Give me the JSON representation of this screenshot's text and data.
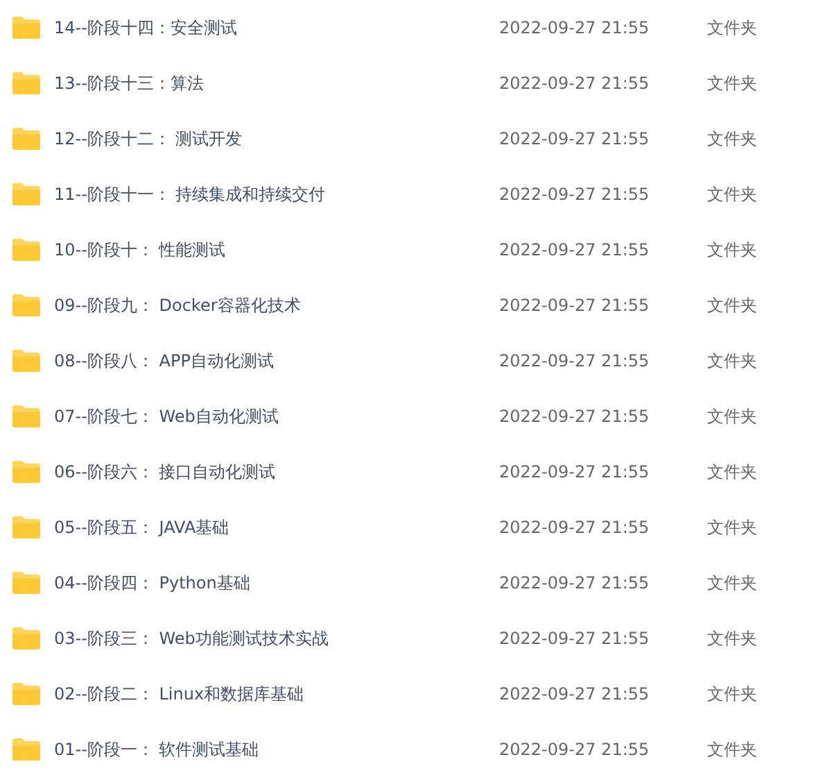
{
  "files": [
    {
      "name": "14--阶段十四：安全测试",
      "modified": "2022-09-27 21:55",
      "type": "文件夹"
    },
    {
      "name": "13--阶段十三：算法",
      "modified": "2022-09-27 21:55",
      "type": "文件夹"
    },
    {
      "name": "12--阶段十二： 测试开发",
      "modified": "2022-09-27 21:55",
      "type": "文件夹"
    },
    {
      "name": "11--阶段十一： 持续集成和持续交付",
      "modified": "2022-09-27 21:55",
      "type": "文件夹"
    },
    {
      "name": "10--阶段十： 性能测试",
      "modified": "2022-09-27 21:55",
      "type": "文件夹"
    },
    {
      "name": "09--阶段九： Docker容器化技术",
      "modified": "2022-09-27 21:55",
      "type": "文件夹"
    },
    {
      "name": "08--阶段八： APP自动化测试",
      "modified": "2022-09-27 21:55",
      "type": "文件夹"
    },
    {
      "name": "07--阶段七： Web自动化测试",
      "modified": "2022-09-27 21:55",
      "type": "文件夹"
    },
    {
      "name": "06--阶段六： 接口自动化测试",
      "modified": "2022-09-27 21:55",
      "type": "文件夹"
    },
    {
      "name": "05--阶段五： JAVA基础",
      "modified": "2022-09-27 21:55",
      "type": "文件夹"
    },
    {
      "name": "04--阶段四： Python基础",
      "modified": "2022-09-27 21:55",
      "type": "文件夹"
    },
    {
      "name": "03--阶段三： Web功能测试技术实战",
      "modified": "2022-09-27 21:55",
      "type": "文件夹"
    },
    {
      "name": "02--阶段二： Linux和数据库基础",
      "modified": "2022-09-27 21:55",
      "type": "文件夹"
    },
    {
      "name": "01--阶段一： 软件测试基础",
      "modified": "2022-09-27 21:55",
      "type": "文件夹"
    }
  ]
}
